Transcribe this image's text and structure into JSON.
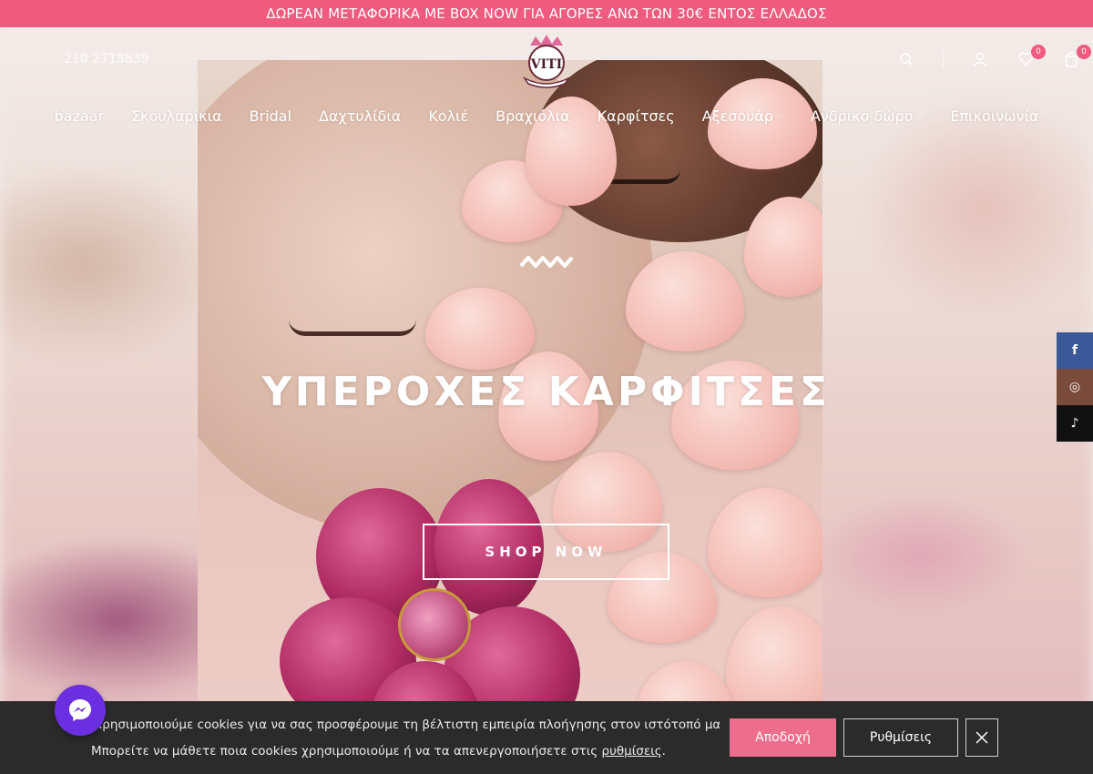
{
  "announcement": "ΔΩΡΕΑΝ ΜΕΤΑΦΟΡΙΚΑ ΜΕ BOX NOW ΓΙΑ ΑΓΟΡΕΣ ΑΝΩ ΤΩΝ 30€ ΕΝΤΟΣ ΕΛΛΑΔΟΣ",
  "header": {
    "phone": "210 2718839",
    "logo_text": "VITI",
    "wishlist_count": "0",
    "cart_count": "0"
  },
  "nav": [
    {
      "label": "bazaar",
      "has_submenu": false
    },
    {
      "label": "Σκουλαρίκια",
      "has_submenu": false
    },
    {
      "label": "Bridal",
      "has_submenu": false
    },
    {
      "label": "Δαχτυλίδια",
      "has_submenu": false
    },
    {
      "label": "Κολιέ",
      "has_submenu": false
    },
    {
      "label": "Βραχιόλια",
      "has_submenu": false
    },
    {
      "label": "Καρφίτσες",
      "has_submenu": false
    },
    {
      "label": "Αξεσουάρ",
      "has_submenu": true
    },
    {
      "label": "Ανδρικό δώρο",
      "has_submenu": true
    },
    {
      "label": "Επικοινωνία",
      "has_submenu": false
    }
  ],
  "hero": {
    "title": "ΥΠΕΡΟΧΕΣ ΚΑΡΦΙΤΣΕΣ",
    "button": "SHOP NOW"
  },
  "social": [
    {
      "icon": "facebook-icon",
      "glyph": "f"
    },
    {
      "icon": "instagram-icon",
      "glyph": "◎"
    },
    {
      "icon": "tiktok-icon",
      "glyph": "♪"
    }
  ],
  "cookie": {
    "line1": "Χρησιμοποιούμε cookies για να σας προσφέρουμε τη βέλτιστη εμπειρία πλοήγησης στον ιστότοπό μας.",
    "line2_prefix": "Μπορείτε να μάθετε ποια cookies χρησιμοποιούμε ή να τα απενεργοποιήσετε στις ",
    "line2_link": "ρυθμίσεις",
    "line2_suffix": ".",
    "accept": "Αποδοχή",
    "settings": "Ρυθμίσεις"
  },
  "colors": {
    "brand_pink": "#ef5a7e",
    "cookie_bg": "#2b2b2b",
    "messenger": "#6b2ee0"
  }
}
